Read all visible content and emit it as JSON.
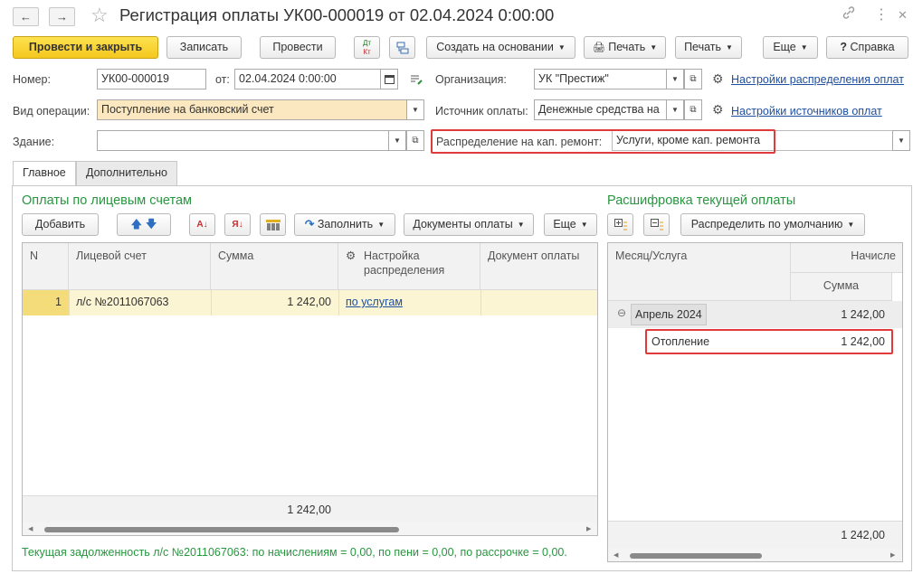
{
  "window": {
    "title": "Регистрация оплаты УК00-000019 от 02.04.2024 0:00:00",
    "nav_back": "←",
    "nav_forward": "→",
    "star": "☆",
    "link_icon": "🔗",
    "more_icon": "⋮",
    "close_icon": "✕"
  },
  "toolbar": {
    "post_close": "Провести и закрыть",
    "write": "Записать",
    "post": "Провести",
    "dt_kt": "Дт Кт",
    "create_based": "Создать на основании",
    "print1": "Печать",
    "print2": "Печать",
    "more": "Еще",
    "help": "Справка"
  },
  "form": {
    "number_label": "Номер:",
    "number_value": "УК00-000019",
    "date_label": "от:",
    "date_value": "02.04.2024  0:00:00",
    "org_label": "Организация:",
    "org_value": "УК \"Престиж\"",
    "dist_settings_link": "Настройки распределения оплат",
    "op_type_label": "Вид операции:",
    "op_type_value": "Поступление на банковский счет",
    "source_label": "Источник оплаты:",
    "source_value": "Денежные средства на",
    "source_settings_link": "Настройки источников оплат",
    "building_label": "Здание:",
    "building_value": "",
    "cap_repair_label": "Распределение на кап. ремонт:",
    "cap_repair_value": "Услуги, кроме кап. ремонта"
  },
  "tabs": [
    "Главное",
    "Дополнительно"
  ],
  "payments": {
    "title": "Оплаты по лицевым счетам",
    "add": "Добавить",
    "fill": "Заполнить",
    "docs": "Документы оплаты",
    "more": "Еще",
    "columns": [
      "N",
      "Лицевой счет",
      "Сумма",
      "Настройка распределения",
      "Документ оплаты"
    ],
    "rows": [
      {
        "n": "1",
        "account": "л/с №2011067063",
        "sum": "1 242,00",
        "setting": "по услугам",
        "doc": ""
      }
    ],
    "total": "1 242,00"
  },
  "breakdown": {
    "title": "Расшифровка текущей оплаты",
    "distribute": "Распределить по умолчанию",
    "col_month": "Месяц/Услуга",
    "col_accrued": "Начисле",
    "col_sum": "Сумма",
    "group_row": {
      "label": "Апрель 2024",
      "sum": "1 242,00",
      "toggle": "⊖"
    },
    "child_row": {
      "label": "Отопление",
      "sum": "1 242,00"
    },
    "total": "1 242,00"
  },
  "status_text": "Текущая задолженность л/с №2011067063: по начислениям = 0,00, по пени = 0,00, по рассрочке = 0,00."
}
